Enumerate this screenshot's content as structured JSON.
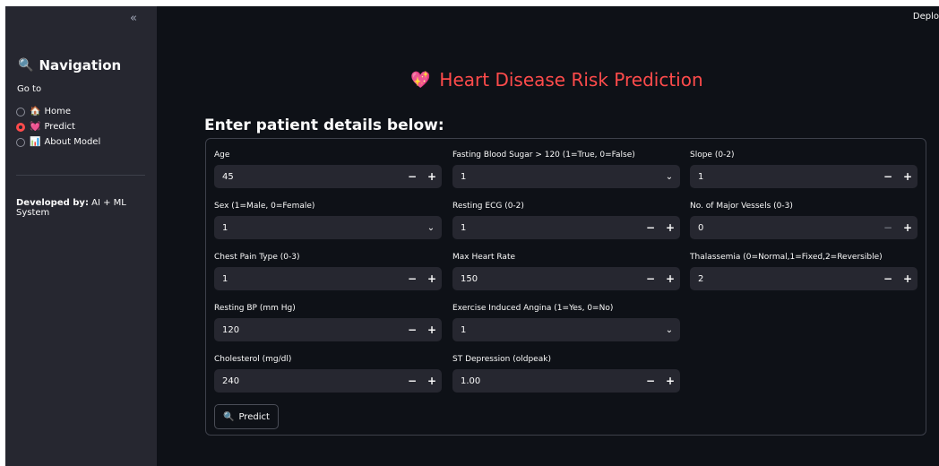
{
  "sidebar": {
    "collapse_glyph": "«",
    "nav_title": "Navigation",
    "nav_icon": "🔍",
    "go_to_label": "Go to",
    "options": [
      {
        "emoji": "🏠",
        "label": "Home",
        "selected": false
      },
      {
        "emoji": "💓",
        "label": "Predict",
        "selected": true
      },
      {
        "emoji": "📊",
        "label": "About Model",
        "selected": false
      }
    ],
    "developed_by_label": "Developed by:",
    "developed_by_value": "AI + ML System"
  },
  "header": {
    "deploy_label": "Deplo"
  },
  "main": {
    "title_icon": "💖",
    "title": "Heart Disease Risk Prediction",
    "subheader": "Enter patient details below:",
    "fields": {
      "age": {
        "label": "Age",
        "value": "45"
      },
      "sex": {
        "label": "Sex (1=Male, 0=Female)",
        "value": "1"
      },
      "cp": {
        "label": "Chest Pain Type (0-3)",
        "value": "1"
      },
      "bp": {
        "label": "Resting BP (mm Hg)",
        "value": "120"
      },
      "chol": {
        "label": "Cholesterol (mg/dl)",
        "value": "240"
      },
      "fbs": {
        "label": "Fasting Blood Sugar > 120 (1=True, 0=False)",
        "value": "1"
      },
      "ecg": {
        "label": "Resting ECG (0-2)",
        "value": "1"
      },
      "hr": {
        "label": "Max Heart Rate",
        "value": "150"
      },
      "angina": {
        "label": "Exercise Induced Angina (1=Yes, 0=No)",
        "value": "1"
      },
      "oldpeak": {
        "label": "ST Depression (oldpeak)",
        "value": "1.00"
      },
      "slope": {
        "label": "Slope (0-2)",
        "value": "1"
      },
      "vessels": {
        "label": "No. of Major Vessels (0-3)",
        "value": "0"
      },
      "thal": {
        "label": "Thalassemia (0=Normal,1=Fixed,2=Reversible)",
        "value": "2"
      }
    },
    "stepper": {
      "minus": "−",
      "plus": "+"
    },
    "dropdown_glyph": "⌄",
    "predict_icon": "🔍",
    "predict_label": "Predict"
  },
  "colors": {
    "accent": "#ff4b4b",
    "background": "#0e1117",
    "sidebar": "#262730",
    "input": "#262730"
  }
}
